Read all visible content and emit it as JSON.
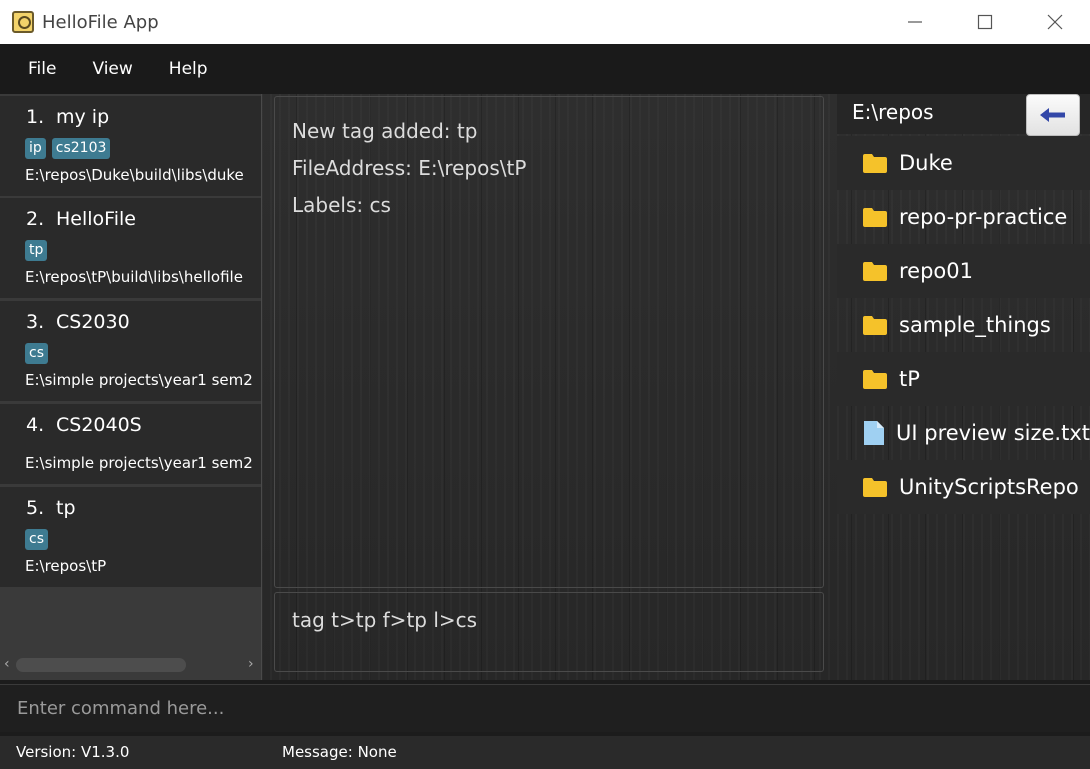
{
  "window": {
    "title": "HelloFile App"
  },
  "menu": {
    "items": [
      "File",
      "View",
      "Help"
    ]
  },
  "file_list": [
    {
      "index": "1.",
      "name": "my ip",
      "tags": [
        "ip",
        "cs2103"
      ],
      "path": "E:\\repos\\Duke\\build\\libs\\duke"
    },
    {
      "index": "2.",
      "name": "HelloFile",
      "tags": [
        "tp"
      ],
      "path": "E:\\repos\\tP\\build\\libs\\hellofile"
    },
    {
      "index": "3.",
      "name": "CS2030",
      "tags": [
        "cs"
      ],
      "path": "E:\\simple projects\\year1 sem2"
    },
    {
      "index": "4.",
      "name": "CS2040S",
      "tags": [],
      "path": "E:\\simple projects\\year1 sem2"
    },
    {
      "index": "5.",
      "name": "tp",
      "tags": [
        "cs"
      ],
      "path": "E:\\repos\\tP"
    }
  ],
  "result": {
    "lines": [
      "New tag added: tp",
      "FileAddress: E:\\repos\\tP",
      "Labels: cs"
    ]
  },
  "history": {
    "last_command": "tag t>tp f>tp l>cs"
  },
  "directory": {
    "path": "E:\\repos",
    "back_icon": "arrow-left-icon",
    "items": [
      {
        "name": "Duke",
        "type": "folder"
      },
      {
        "name": "repo-pr-practice",
        "type": "folder"
      },
      {
        "name": "repo01",
        "type": "folder"
      },
      {
        "name": "sample_things",
        "type": "folder"
      },
      {
        "name": "tP",
        "type": "folder"
      },
      {
        "name": "UI preview size.txt",
        "type": "file"
      },
      {
        "name": "UnityScriptsRepo",
        "type": "folder"
      }
    ]
  },
  "command": {
    "placeholder": "Enter command here...",
    "value": ""
  },
  "status": {
    "version": "Version:  V1.3.0",
    "message": "Message:  None"
  },
  "colors": {
    "tag_bg": "#3e7b91",
    "folder": "#f5c22a",
    "file": "#9fd0f2",
    "back_arrow": "#3347a8"
  }
}
